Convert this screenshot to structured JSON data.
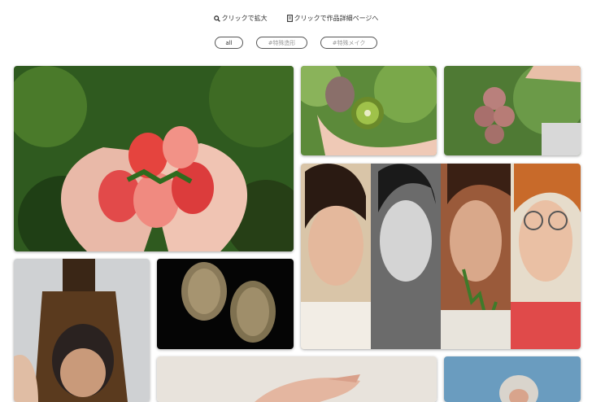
{
  "hints": {
    "zoom_label": "クリックで拡大",
    "detail_label": "クリックで作品詳細ページへ"
  },
  "filters": [
    {
      "label": "all"
    },
    {
      "label": "#特殊造形"
    },
    {
      "label": "#特殊メイク"
    }
  ],
  "icons": {
    "zoom": "magnifier-icon",
    "detail": "document-icon"
  },
  "colors": {
    "pill_border": "#555555",
    "page_bg": "#ffffff"
  }
}
